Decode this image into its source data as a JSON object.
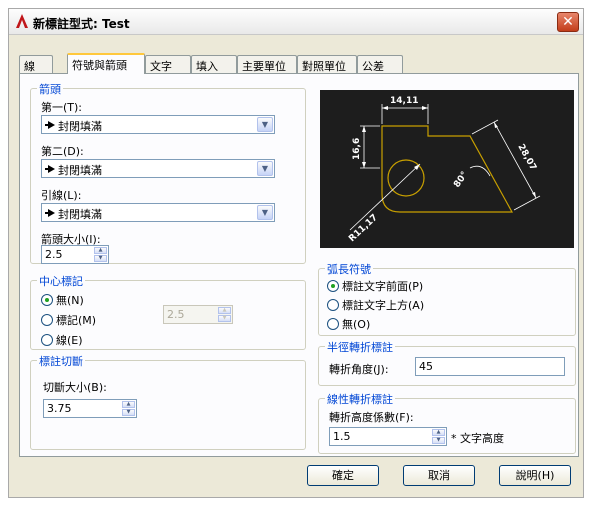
{
  "window": {
    "title": "新標註型式: Test",
    "close_label": "✕"
  },
  "tabs": [
    {
      "label": "線"
    },
    {
      "label": "符號與箭頭"
    },
    {
      "label": "文字"
    },
    {
      "label": "填入"
    },
    {
      "label": "主要單位"
    },
    {
      "label": "對照單位"
    },
    {
      "label": "公差"
    }
  ],
  "arrowheads": {
    "title": "箭頭",
    "first_label": "第一(T):",
    "first_value": "封閉填滿",
    "second_label": "第二(D):",
    "second_value": "封閉填滿",
    "leader_label": "引線(L):",
    "leader_value": "封閉填滿",
    "size_label": "箭頭大小(I):",
    "size_value": "2.5"
  },
  "center_marks": {
    "title": "中心標記",
    "options": [
      "無(N)",
      "標記(M)",
      "線(E)"
    ],
    "selected": "無(N)",
    "size_value": "2.5"
  },
  "dim_break": {
    "title": "標註切斷",
    "size_label": "切斷大小(B):",
    "size_value": "3.75"
  },
  "preview": {
    "dim_top": "14,11",
    "dim_left": "16,6",
    "dim_right": "28,07",
    "angle": "80°",
    "radius": "R11,17",
    "colors": {
      "background": "#1d1d1d",
      "geometry": "#c8a000",
      "dimension": "#ffffff"
    }
  },
  "arc_symbol": {
    "title": "弧長符號",
    "options": [
      "標註文字前面(P)",
      "標註文字上方(A)",
      "無(O)"
    ],
    "selected": "標註文字前面(P)"
  },
  "radius_jog": {
    "title": "半徑轉折標註",
    "angle_label": "轉折角度(J):",
    "angle_value": "45"
  },
  "linear_jog": {
    "title": "線性轉折標註",
    "height_label": "轉折高度係數(F):",
    "height_value": "1.5",
    "suffix": "* 文字高度"
  },
  "buttons": {
    "ok": "確定",
    "cancel": "取消",
    "help": "說明(H)"
  }
}
